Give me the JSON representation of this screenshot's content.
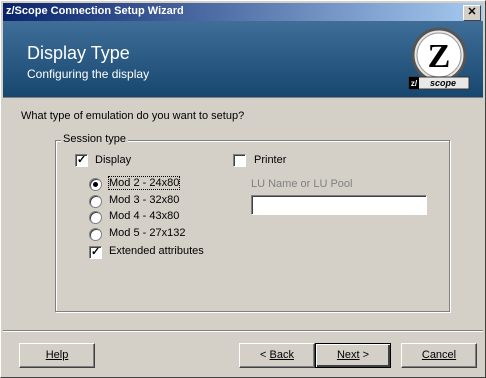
{
  "window": {
    "title": "z/Scope Connection Setup Wizard",
    "close_glyph": "✕"
  },
  "banner": {
    "title": "Display Type",
    "subtitle": "Configuring the display",
    "logo_letter": "Z",
    "logo_brand": "scope",
    "logo_prefix": "z/"
  },
  "question": "What type of emulation do you want to setup?",
  "session": {
    "legend": "Session type",
    "display": {
      "label": "Display",
      "checked": true
    },
    "printer": {
      "label": "Printer",
      "checked": false
    },
    "models": [
      {
        "label": "Mod 2 - 24x80",
        "selected": true
      },
      {
        "label": "Mod 3 - 32x80",
        "selected": false
      },
      {
        "label": "Mod 4 - 43x80",
        "selected": false
      },
      {
        "label": "Mod 5 - 27x132",
        "selected": false
      }
    ],
    "extended": {
      "label": "Extended attributes",
      "checked": true
    },
    "lu": {
      "label": "LU Name or LU Pool",
      "value": ""
    }
  },
  "buttons": {
    "help": {
      "label": "Help"
    },
    "back": {
      "prefix": "< ",
      "label": "Back"
    },
    "next": {
      "label": "Next",
      "suffix": " >"
    },
    "cancel": {
      "label": "Cancel"
    }
  }
}
